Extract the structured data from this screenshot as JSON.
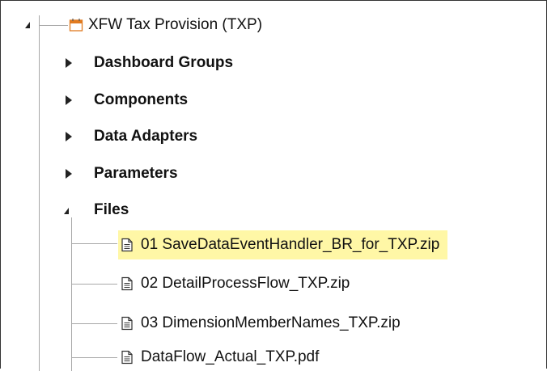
{
  "tree": {
    "root": {
      "label": "XFW Tax Provision (TXP)",
      "icon": "calendar-icon"
    },
    "folders": [
      {
        "label": "Dashboard Groups",
        "expanded": false
      },
      {
        "label": "Components",
        "expanded": false
      },
      {
        "label": "Data Adapters",
        "expanded": false
      },
      {
        "label": "Parameters",
        "expanded": false
      },
      {
        "label": "Files",
        "expanded": true
      }
    ],
    "files": [
      {
        "label": "01 SaveDataEventHandler_BR_for_TXP.zip",
        "icon": "document-icon",
        "highlighted": true
      },
      {
        "label": "02 DetailProcessFlow_TXP.zip",
        "icon": "document-icon",
        "highlighted": false
      },
      {
        "label": "03 DimensionMemberNames_TXP.zip",
        "icon": "document-icon",
        "highlighted": false
      },
      {
        "label": "DataFlow_Actual_TXP.pdf",
        "icon": "document-icon",
        "highlighted": false
      }
    ]
  },
  "colors": {
    "highlight": "#fff7a6",
    "connector": "#a8a8a8",
    "calendar_icon_accent": "#e07a1f"
  }
}
